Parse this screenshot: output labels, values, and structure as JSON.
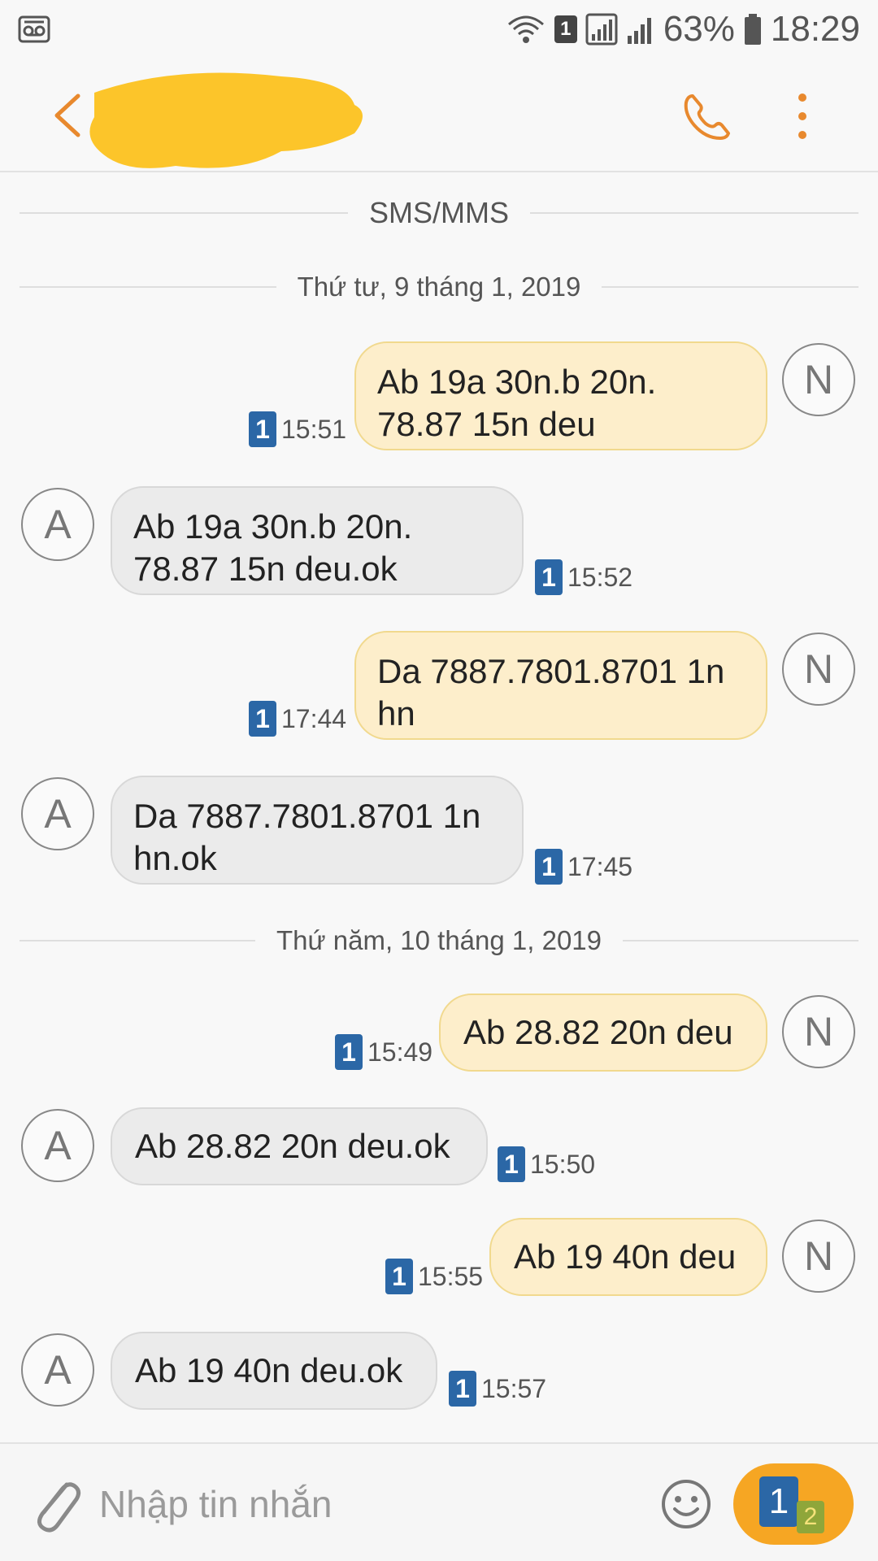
{
  "status_bar": {
    "sim_number": "1",
    "battery": "63%",
    "time": "18:29"
  },
  "header": {
    "contact_name": "",
    "icons": [
      "back-icon",
      "phone-icon",
      "more-vertical-icon"
    ]
  },
  "conversation": {
    "type_label": "SMS/MMS",
    "date_1": "Thứ tư, 9 tháng 1, 2019",
    "date_2": "Thứ năm, 10 tháng 1, 2019",
    "messages": [
      {
        "dir": "out",
        "avatar": "N",
        "sim": "1",
        "time": "15:51",
        "line1": "Ab 19a 30n.b 20n.",
        "line2": "78.87 15n deu"
      },
      {
        "dir": "in",
        "avatar": "A",
        "sim": "1",
        "time": "15:52",
        "line1": "Ab 19a 30n.b 20n.",
        "line2": "78.87 15n deu.ok"
      },
      {
        "dir": "out",
        "avatar": "N",
        "sim": "1",
        "time": "17:44",
        "line1": "Da 7887.7801.8701 1n",
        "line2": "hn"
      },
      {
        "dir": "in",
        "avatar": "A",
        "sim": "1",
        "time": "17:45",
        "line1": "Da 7887.7801.8701 1n",
        "line2": "hn.ok"
      },
      {
        "dir": "out",
        "avatar": "N",
        "sim": "1",
        "time": "15:49",
        "line1": "Ab 28.82 20n deu"
      },
      {
        "dir": "in",
        "avatar": "A",
        "sim": "1",
        "time": "15:50",
        "line1": "Ab 28.82 20n deu.ok"
      },
      {
        "dir": "out",
        "avatar": "N",
        "sim": "1",
        "time": "15:55",
        "line1": "Ab 19 40n deu"
      },
      {
        "dir": "in",
        "avatar": "A",
        "sim": "1",
        "time": "15:57",
        "line1": "Ab 19 40n deu.ok"
      }
    ]
  },
  "composer": {
    "placeholder": "Nhập tin nhắn",
    "send_sim_primary": "1",
    "send_sim_secondary": "2",
    "colors": {
      "send_button": "#f6a623",
      "sim_badge": "#2b67a6",
      "outgoing_bubble": "#fdeecb",
      "incoming_bubble": "#ebebeb"
    }
  }
}
